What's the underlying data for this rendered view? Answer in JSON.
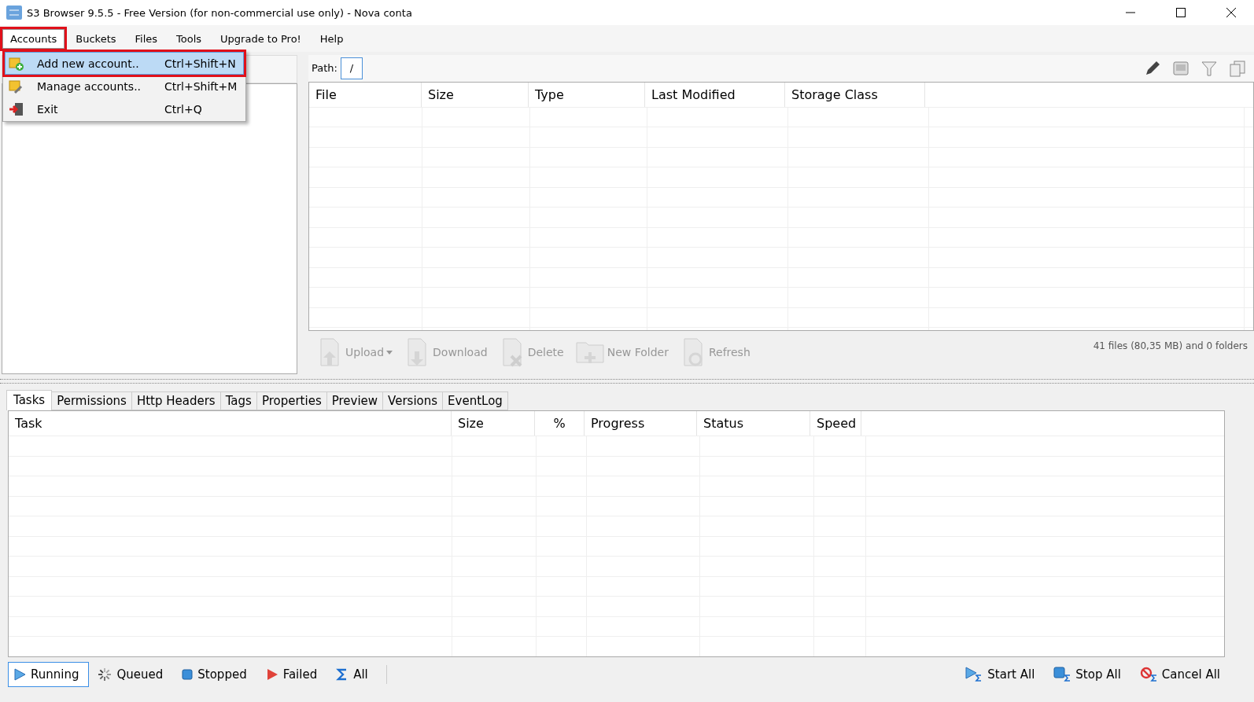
{
  "window": {
    "title": "S3 Browser 9.5.5 - Free Version (for non-commercial use only) - Nova conta"
  },
  "menu_bar": [
    {
      "label": "Accounts",
      "open": true,
      "marked": true
    },
    {
      "label": "Buckets",
      "open": false,
      "marked": false
    },
    {
      "label": "Files",
      "open": false,
      "marked": false
    },
    {
      "label": "Tools",
      "open": false,
      "marked": false
    },
    {
      "label": "Upgrade to Pro!",
      "open": false,
      "marked": false
    },
    {
      "label": "Help",
      "open": false,
      "marked": false
    }
  ],
  "accounts_menu": [
    {
      "kind": "add",
      "label": "Add new account..",
      "shortcut": "Ctrl+Shift+N",
      "selected": true,
      "marked": true
    },
    {
      "kind": "manage",
      "label": "Manage accounts..",
      "shortcut": "Ctrl+Shift+M",
      "selected": false,
      "marked": false
    },
    {
      "kind": "exit",
      "label": "Exit",
      "shortcut": "Ctrl+Q",
      "selected": false,
      "marked": false
    }
  ],
  "path": {
    "label": "Path:",
    "value": "/"
  },
  "files_table": {
    "columns": [
      "File",
      "Size",
      "Type",
      "Last Modified",
      "Storage Class"
    ]
  },
  "file_actions": [
    {
      "kind": "upload",
      "label": "Upload",
      "disabled": true
    },
    {
      "kind": "download",
      "label": "Download",
      "disabled": true
    },
    {
      "kind": "delete",
      "label": "Delete",
      "disabled": true
    },
    {
      "kind": "folder",
      "label": "New Folder",
      "disabled": true
    },
    {
      "kind": "refresh",
      "label": "Refresh",
      "disabled": true
    }
  ],
  "files_summary": "41 files (80,35 MB) and 0 folders",
  "tabs": [
    {
      "label": "Tasks",
      "selected": true
    },
    {
      "label": "Permissions",
      "selected": false
    },
    {
      "label": "Http Headers",
      "selected": false
    },
    {
      "label": "Tags",
      "selected": false
    },
    {
      "label": "Properties",
      "selected": false
    },
    {
      "label": "Preview",
      "selected": false
    },
    {
      "label": "Versions",
      "selected": false
    },
    {
      "label": "EventLog",
      "selected": false
    }
  ],
  "tasks_table": {
    "columns": [
      "Task",
      "Size",
      "%",
      "Progress",
      "Status",
      "Speed"
    ]
  },
  "task_filters": [
    {
      "kind": "running",
      "label": "Running",
      "selected": true
    },
    {
      "kind": "queued",
      "label": "Queued",
      "selected": false
    },
    {
      "kind": "stopped",
      "label": "Stopped",
      "selected": false
    },
    {
      "kind": "failed",
      "label": "Failed",
      "selected": false
    },
    {
      "kind": "all",
      "label": "All",
      "selected": false
    }
  ],
  "task_actions": [
    {
      "kind": "start",
      "label": "Start All"
    },
    {
      "kind": "stop",
      "label": "Stop All"
    },
    {
      "kind": "cancel",
      "label": "Cancel All"
    }
  ]
}
